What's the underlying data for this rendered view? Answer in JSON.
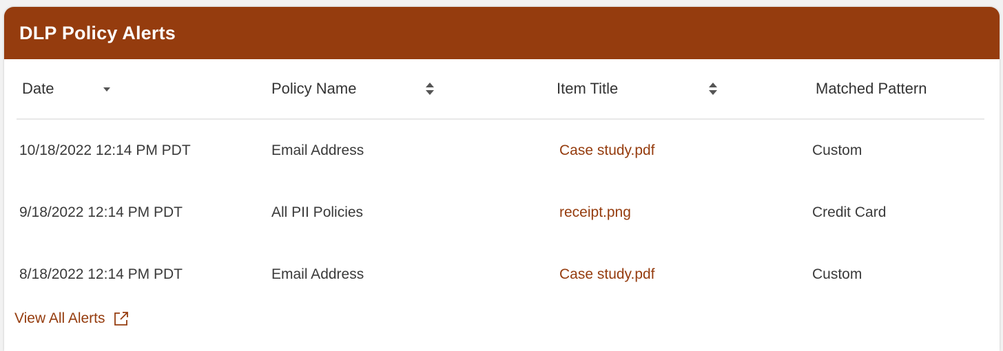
{
  "card": {
    "title": "DLP Policy Alerts"
  },
  "table": {
    "columns": [
      {
        "label": "Date",
        "sort": "descending"
      },
      {
        "label": "Policy Name",
        "sort": "sortable"
      },
      {
        "label": "Item Title",
        "sort": "sortable"
      },
      {
        "label": "Matched Pattern",
        "sort": "none"
      }
    ],
    "rows": [
      {
        "date": "10/18/2022 12:14 PM PDT",
        "policy": "Email Address",
        "item": "Case study.pdf",
        "pattern": "Custom"
      },
      {
        "date": "9/18/2022 12:14 PM PDT",
        "policy": "All PII Policies",
        "item": "receipt.png",
        "pattern": "Credit Card"
      },
      {
        "date": "8/18/2022 12:14 PM PDT",
        "policy": "Email Address",
        "item": "Case study.pdf",
        "pattern": "Custom"
      }
    ]
  },
  "footer": {
    "view_all_label": "View All Alerts",
    "icon": "external-link-icon"
  },
  "colors": {
    "header_bg": "#953c0e",
    "link": "#953c0e",
    "text": "#3a3a3a"
  }
}
